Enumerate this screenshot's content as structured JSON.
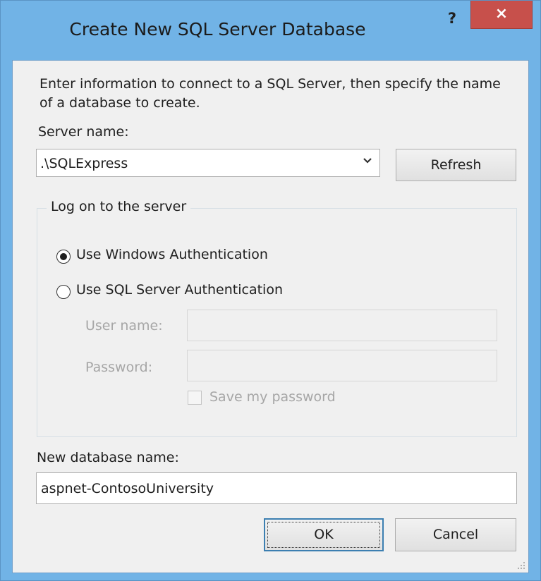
{
  "dialog": {
    "title": "Create New SQL Server Database",
    "help_label": "?",
    "close_label": "×"
  },
  "intro_text": "Enter information to connect to a SQL Server, then specify the name of a database to create.",
  "server": {
    "label": "Server name:",
    "value": ".\\SQLExpress",
    "refresh_label": "Refresh"
  },
  "logon": {
    "group_title": "Log on to the server",
    "windows_auth_label": "Use Windows Authentication",
    "sql_auth_label": "Use SQL Server Authentication",
    "selected": "windows",
    "user_name_label": "User name:",
    "password_label": "Password:",
    "save_password_label": "Save my password"
  },
  "database": {
    "label": "New database name:",
    "value": "aspnet-ContosoUniversity"
  },
  "buttons": {
    "ok_label": "OK",
    "cancel_label": "Cancel"
  }
}
